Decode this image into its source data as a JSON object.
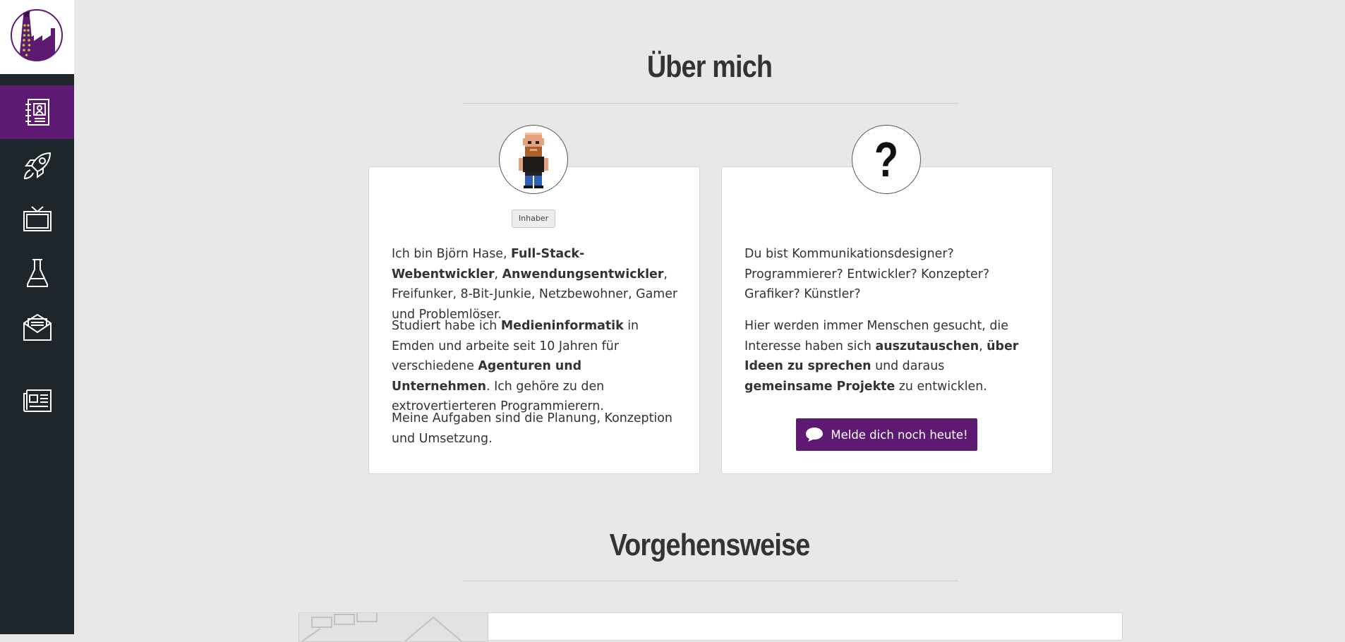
{
  "brand": {
    "logo": "factory-tie-logo"
  },
  "colors": {
    "accent": "#5e1a73",
    "sidebar": "#1e262b",
    "background": "#e8e8e8"
  },
  "sidebar": {
    "items": [
      {
        "icon": "contact-book-icon",
        "active": true
      },
      {
        "icon": "rocket-icon",
        "active": false
      },
      {
        "icon": "tv-icon",
        "active": false
      },
      {
        "icon": "flask-icon",
        "active": false
      },
      {
        "icon": "mail-icon",
        "active": false
      },
      {
        "icon": "newspaper-icon",
        "active": false
      }
    ]
  },
  "about": {
    "title": "Über mich",
    "owner_card": {
      "avatar": "pixel-avatar",
      "badge": "Inhaber",
      "p1": {
        "t1": "Ich bin Björn Hase, ",
        "b1": "Full-Stack-Webentwickler",
        "t2": ", ",
        "b2": "Anwendungsentwickler",
        "t3": ", Freifunker, 8-Bit-Junkie, Netzbewohner, Gamer und Problemlöser."
      },
      "p2": {
        "t1": "Studiert habe ich ",
        "b1": "Medieninformatik",
        "t2": " in Emden und arbeite seit 10 Jahren für verschiedene ",
        "b2": "Agenturen und Unternehmen",
        "t3": ". Ich gehöre zu den extrovertierteren Programmierern."
      },
      "p3": "Meine Aufgaben sind die Planung, Konzeption und Umsetzung."
    },
    "join_card": {
      "avatar_symbol": "?",
      "p1": "Du bist Kommunikationsdesigner? Programmierer? Entwickler? Konzepter? Grafiker? Künstler?",
      "p2": {
        "t1": "Hier werden immer Menschen gesucht, die Interesse haben sich ",
        "b1": "auszutauschen",
        "t2": ", ",
        "b2": "über Ideen zu sprechen",
        "t3": " und daraus ",
        "b3": "gemeinsame Projekte",
        "t4": " zu entwicklen."
      },
      "cta_label": "Melde dich noch heute!",
      "cta_icon": "speech-bubble-icon"
    }
  },
  "process": {
    "title": "Vorgehensweise"
  }
}
